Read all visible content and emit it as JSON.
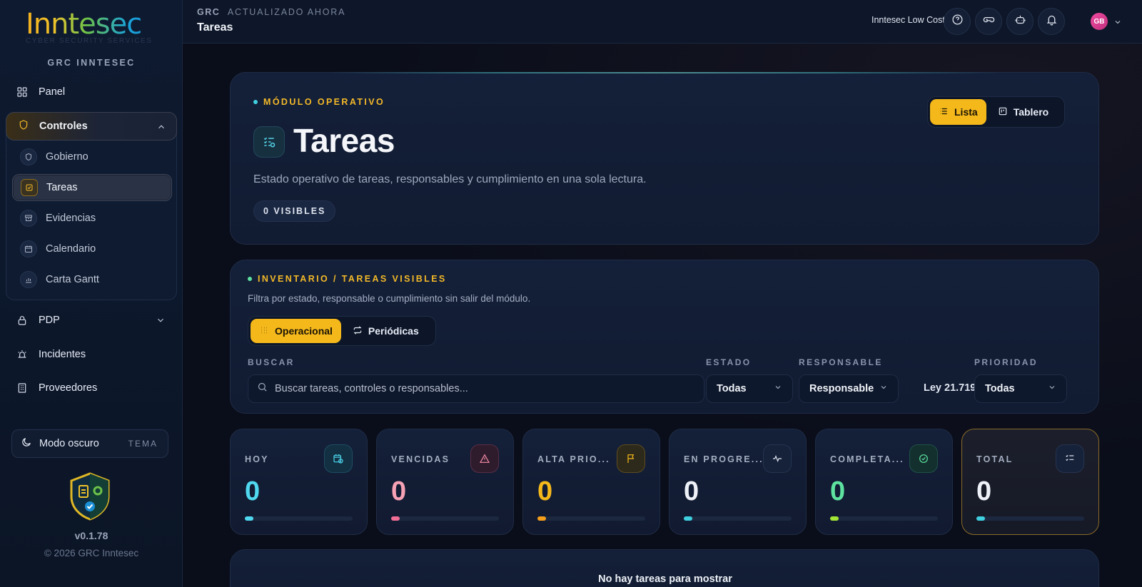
{
  "brand": {
    "logo_text": "Inntesec",
    "logo_sub": "CYBER SECURITY SERVICES",
    "label": "GRC INNTESEC"
  },
  "sidebar": {
    "items": [
      {
        "label": "Panel",
        "icon": "grid-icon"
      },
      {
        "label": "Controles",
        "icon": "shield-icon"
      },
      {
        "label": "PDP",
        "icon": "lock-icon"
      },
      {
        "label": "Incidentes",
        "icon": "alarm-icon"
      },
      {
        "label": "Proveedores",
        "icon": "building-icon"
      }
    ],
    "subitems": [
      {
        "label": "Gobierno",
        "icon": "shield-icon"
      },
      {
        "label": "Tareas",
        "icon": "check-square-icon",
        "active": true
      },
      {
        "label": "Evidencias",
        "icon": "archive-icon"
      },
      {
        "label": "Calendario",
        "icon": "calendar-icon"
      },
      {
        "label": "Carta Gantt",
        "icon": "bar-chart-icon"
      }
    ],
    "theme": {
      "label": "Modo oscuro",
      "tag": "TEMA"
    },
    "version": "v0.1.78",
    "copyright": "© 2026 GRC Inntesec"
  },
  "topbar": {
    "section": "GRC",
    "status": "ACTUALIZADO AHORA",
    "title": "Tareas",
    "company": "Inntesec Low Cost",
    "avatar_initials": "GB"
  },
  "hero": {
    "eyebrow": "MÓDULO OPERATIVO",
    "title": "Tareas",
    "description": "Estado operativo de tareas, responsables y cumplimiento en una sola lectura.",
    "visible_count": "0 VISIBLES",
    "views": [
      {
        "label": "Lista",
        "active": true
      },
      {
        "label": "Tablero",
        "active": false
      }
    ]
  },
  "filters": {
    "eyebrow": "INVENTARIO / TAREAS VISIBLES",
    "subtitle": "Filtra por estado, responsable o cumplimiento sin salir del módulo.",
    "modes": [
      {
        "label": "Operacional",
        "active": true
      },
      {
        "label": "Periódicas",
        "active": false
      }
    ],
    "search_label": "BUSCAR",
    "search_placeholder": "Buscar tareas, controles o responsables...",
    "estado_label": "ESTADO",
    "estado_value": "Todas",
    "responsable_label": "RESPONSABLE",
    "responsable_value": "Responsable",
    "law": "Ley 21.719",
    "prioridad_label": "PRIORIDAD",
    "prioridad_value": "Todas"
  },
  "stats": [
    {
      "label": "HOY",
      "value": "0",
      "color": "#4fd8ef",
      "icon": "calendar-clock-icon"
    },
    {
      "label": "VENCIDAS",
      "value": "0",
      "color": "#f7a1b5",
      "icon": "warning-icon"
    },
    {
      "label": "ALTA PRIO...",
      "value": "0",
      "color": "#f5b81b",
      "icon": "flag-icon"
    },
    {
      "label": "EN PROGRE...",
      "value": "0",
      "color": "#eef1f7",
      "icon": "activity-icon"
    },
    {
      "label": "COMPLETA...",
      "value": "0",
      "color": "#5ee2a0",
      "icon": "check-circle-icon"
    },
    {
      "label": "TOTAL",
      "value": "0",
      "color": "#eef1f7",
      "icon": "list-check-icon"
    }
  ],
  "empty_state": "No hay tareas para mostrar",
  "colors": {
    "accent": "#f5b81b",
    "teal": "#3fd0e0",
    "background": "#0a0f1c"
  }
}
